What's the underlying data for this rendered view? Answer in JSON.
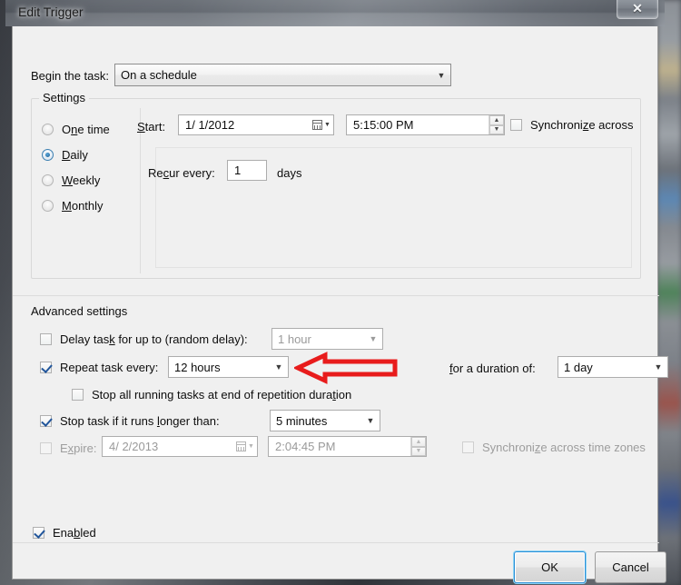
{
  "window": {
    "title": "Edit Trigger",
    "close_label": "✕"
  },
  "begin": {
    "label": "Begin the task:",
    "value": "On a schedule"
  },
  "settings": {
    "caption": "Settings",
    "radios": [
      {
        "label_pre": "O",
        "label_accel": "n",
        "label_post": "e time",
        "checked": false,
        "name": "one-time"
      },
      {
        "label_pre": "",
        "label_accel": "D",
        "label_post": "aily",
        "checked": true,
        "name": "daily"
      },
      {
        "label_pre": "",
        "label_accel": "W",
        "label_post": "eekly",
        "checked": false,
        "name": "weekly"
      },
      {
        "label_pre": "",
        "label_accel": "M",
        "label_post": "onthly",
        "checked": false,
        "name": "monthly"
      }
    ],
    "start_label": "Start:",
    "start_date": "1/  1/2012",
    "start_time": "5:15:00 PM",
    "sync_label": "Synchronize across",
    "sync_checked": false,
    "recur_label": "Recur every:",
    "recur_value": "1",
    "recur_units": "days"
  },
  "advanced": {
    "caption": "Advanced settings",
    "delay_label_pre": "Delay tas",
    "delay_label_accel": "k",
    "delay_label_post": " for up to (random delay):",
    "delay_checked": false,
    "delay_value": "1 hour",
    "repeat_label": "Repeat task every:",
    "repeat_checked": true,
    "repeat_value": "12 hours",
    "duration_label_accel": "f",
    "duration_label_post": "or a duration of:",
    "duration_value": "1 day",
    "stop_all_label_pre": "Stop all running tasks at end of repetition dura",
    "stop_all_label_accel": "t",
    "stop_all_label_post": "ion",
    "stop_all_checked": false,
    "stop_longer_label_pre": "Stop task if it runs ",
    "stop_longer_label_accel": "l",
    "stop_longer_label_post": "onger than:",
    "stop_longer_checked": true,
    "stop_longer_value": "5 minutes",
    "expire_label_pre": "E",
    "expire_label_accel": "x",
    "expire_label_post": "pire:",
    "expire_checked": false,
    "expire_date": "4/  2/2013",
    "expire_time": "2:04:45 PM",
    "sync_tz_label_pre": "Synchroni",
    "sync_tz_label_accel": "z",
    "sync_tz_label_post": "e across time zones",
    "sync_tz_checked": false
  },
  "enabled": {
    "label_pre": "Ena",
    "label_accel": "b",
    "label_post": "led",
    "checked": true
  },
  "footer": {
    "ok_label": "OK",
    "cancel_label": "Cancel"
  },
  "annotation": {
    "arrow_color": "#e81c1c",
    "arrow_direction": "left",
    "points_at": "repeat-task-every-combo"
  }
}
